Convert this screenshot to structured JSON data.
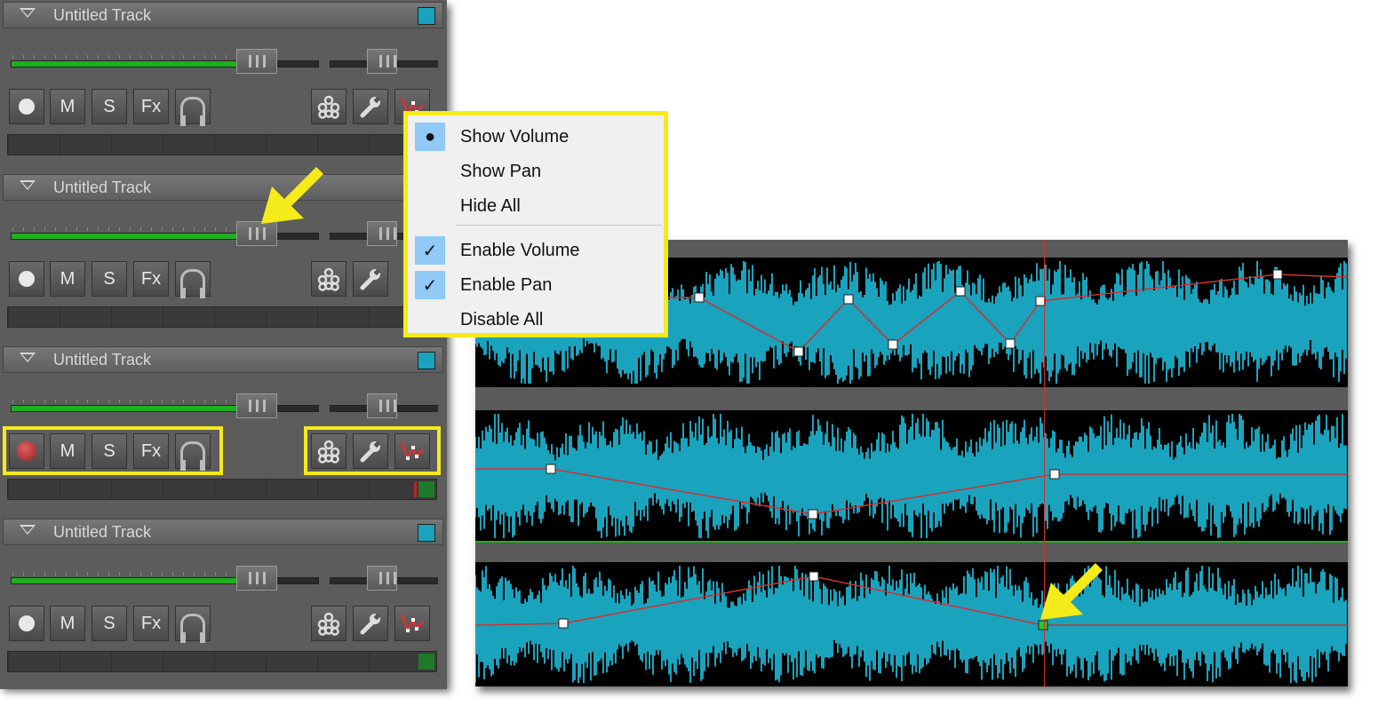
{
  "tracks": [
    {
      "title": "Untitled Track",
      "armed": false
    },
    {
      "title": "Untitled Track",
      "armed": false
    },
    {
      "title": "Untitled Track",
      "armed": true
    },
    {
      "title": "Untitled Track",
      "armed": false
    }
  ],
  "buttons": {
    "mute": "M",
    "solo": "S",
    "fx": "Fx"
  },
  "menu": {
    "items": [
      {
        "label": "Show Volume",
        "mark": "●"
      },
      {
        "label": "Show Pan",
        "mark": ""
      },
      {
        "label": "Hide All",
        "mark": ""
      },
      {
        "label": "Enable Volume",
        "mark": "✓"
      },
      {
        "label": "Enable Pan",
        "mark": "✓"
      },
      {
        "label": "Disable All",
        "mark": ""
      }
    ]
  },
  "colors": {
    "waveform": "#1aa3bd",
    "envelope": "#d03030",
    "highlight": "#f5ea1a",
    "selected_node": "#22cc22"
  },
  "icons": [
    "record-icon",
    "headphones-icon",
    "effects-icon",
    "wrench-icon",
    "envelope-icon",
    "collapse-icon"
  ]
}
